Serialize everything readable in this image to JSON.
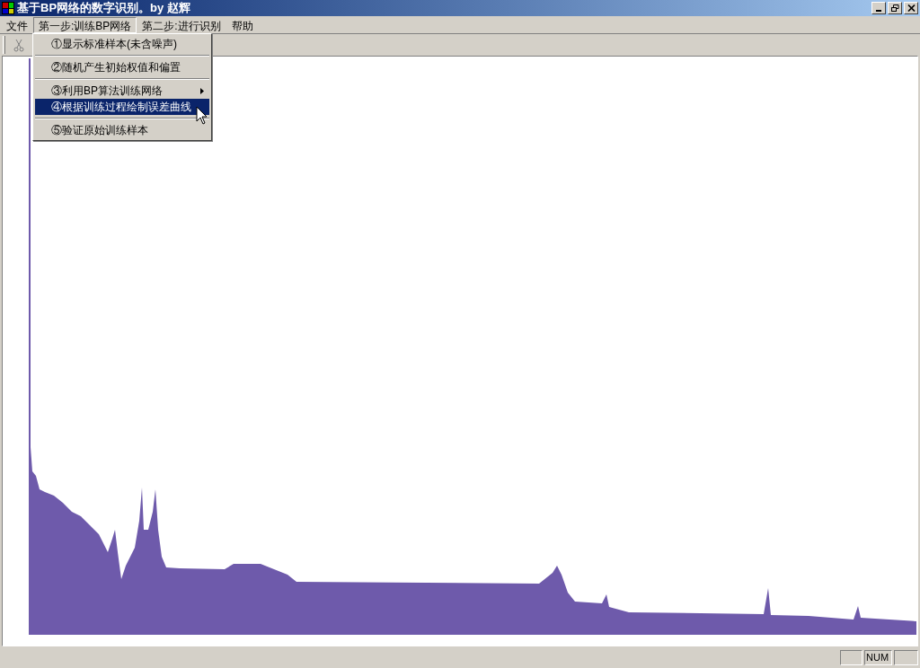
{
  "window": {
    "title": "基于BP网络的数字识别。by 赵辉"
  },
  "menu_bar": [
    {
      "label": "文件",
      "selected": false
    },
    {
      "label": "第一步:训练BP网络",
      "selected": true
    },
    {
      "label": "第二步:进行识别",
      "selected": false
    },
    {
      "label": "帮助",
      "selected": false
    }
  ],
  "dropdown": {
    "items": [
      {
        "label": "①显示标准样本(未含噪声)",
        "selected": false,
        "submenu": false,
        "separator_after": true
      },
      {
        "label": "②随机产生初始权值和偏置",
        "selected": false,
        "submenu": false,
        "separator_after": true
      },
      {
        "label": "③利用BP算法训练网络",
        "selected": false,
        "submenu": true,
        "separator_after": false
      },
      {
        "label": "④根据训练过程绘制误差曲线",
        "selected": true,
        "submenu": false,
        "separator_after": true
      },
      {
        "label": "⑤验证原始训练样本",
        "selected": false,
        "submenu": false,
        "separator_after": false
      }
    ]
  },
  "status_bar": {
    "indicator": "NUM"
  }
}
